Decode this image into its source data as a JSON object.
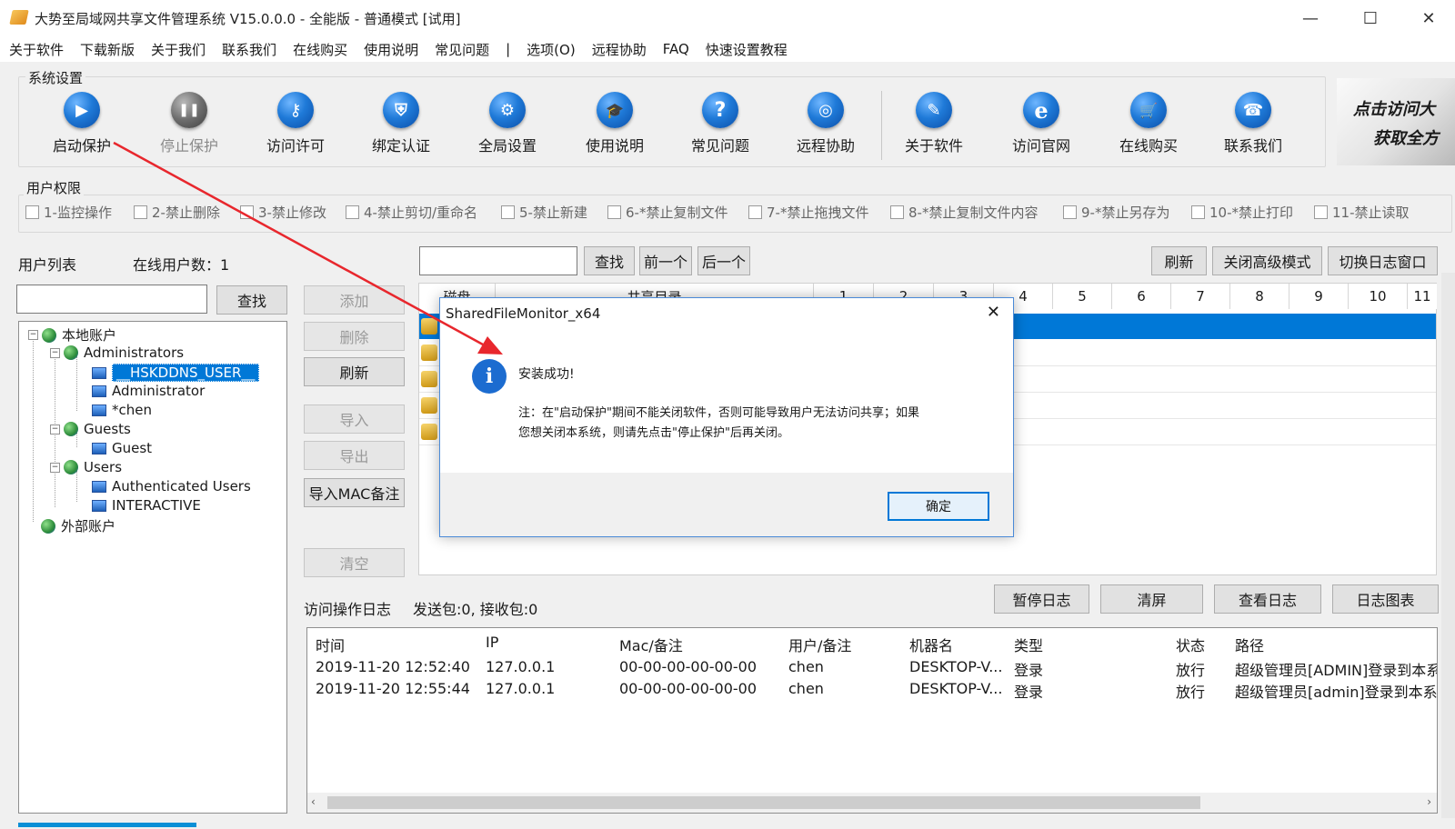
{
  "window": {
    "title": "大势至局域网共享文件管理系统 V15.0.0.0 - 全能版 - 普通模式 [试用]",
    "minimize": "—",
    "maximize": "☐",
    "close": "✕"
  },
  "menu": [
    "关于软件",
    "下载新版",
    "关于我们",
    "联系我们",
    "在线购买",
    "使用说明",
    "常见问题",
    "|",
    "选项(O)",
    "远程协助",
    "FAQ",
    "快速设置教程"
  ],
  "system_settings": {
    "title": "系统设置",
    "tools": [
      {
        "label": "启动保护",
        "icon": "play-icon",
        "glyph": "▶",
        "disabled": false
      },
      {
        "label": "停止保护",
        "icon": "pause-icon",
        "glyph": "❚❚",
        "disabled": true
      },
      {
        "label": "访问许可",
        "icon": "key-icon",
        "glyph": "⚷",
        "disabled": false
      },
      {
        "label": "绑定认证",
        "icon": "shield-icon",
        "glyph": "⛨",
        "disabled": false
      },
      {
        "label": "全局设置",
        "icon": "gear-icon",
        "glyph": "⚙",
        "disabled": false
      },
      {
        "label": "使用说明",
        "icon": "graduation-cap-icon",
        "glyph": "🎓",
        "disabled": false
      },
      {
        "label": "常见问题",
        "icon": "question-icon",
        "glyph": "?",
        "disabled": false
      },
      {
        "label": "远程协助",
        "icon": "globe-hand-icon",
        "glyph": "◎",
        "disabled": false
      },
      {
        "label": "关于软件",
        "icon": "notepad-icon",
        "glyph": "✎",
        "disabled": false
      },
      {
        "label": "访问官网",
        "icon": "ie-icon",
        "glyph": "e",
        "disabled": false
      },
      {
        "label": "在线购买",
        "icon": "cart-icon",
        "glyph": "🛒",
        "disabled": false
      },
      {
        "label": "联系我们",
        "icon": "phone-icon",
        "glyph": "☎",
        "disabled": false
      }
    ],
    "banner_line1": "点击访问大",
    "banner_line2": "获取全方"
  },
  "permissions": {
    "title": "用户权限",
    "items": [
      "1-监控操作",
      "2-禁止删除",
      "3-禁止修改",
      "4-禁止剪切/重命名",
      "5-禁止新建",
      "6-*禁止复制文件",
      "7-*禁止拖拽文件",
      "8-*禁止复制文件内容",
      "9-*禁止另存为",
      "10-*禁止打印",
      "11-禁止读取"
    ]
  },
  "users": {
    "list_label": "用户列表",
    "online_label": "在线用户数：1",
    "search_value": "",
    "search_button": "查找",
    "tree": {
      "local": "本地账户",
      "administrators": "Administrators",
      "hskddns": "__HSKDDNS_USER__",
      "administrator": "Administrator",
      "chen": "*chen",
      "guests": "Guests",
      "guest": "Guest",
      "users_group": "Users",
      "auth_users": "Authenticated Users",
      "interactive": "INTERACTIVE",
      "external": "外部账户"
    }
  },
  "actions": {
    "add": "添加",
    "delete": "删除",
    "refresh": "刷新",
    "import": "导入",
    "export": "导出",
    "import_mac": "导入MAC备注",
    "clear": "清空"
  },
  "share": {
    "search_value": "",
    "find": "查找",
    "prev": "前一个",
    "next": "后一个",
    "refresh": "刷新",
    "close_advanced": "关闭高级模式",
    "switch_log": "切换日志窗口",
    "col_disk": "磁盘",
    "col_dir": "共享目录",
    "num_cols": [
      "1",
      "2",
      "3",
      "4",
      "5",
      "6",
      "7",
      "8",
      "9",
      "10",
      "11"
    ]
  },
  "log": {
    "title": "访问操作日志",
    "packets": "发送包:0, 接收包:0",
    "pause": "暂停日志",
    "clear_screen": "清屏",
    "view": "查看日志",
    "chart": "日志图表",
    "headers": [
      "时间",
      "IP",
      "Mac/备注",
      "用户/备注",
      "机器名",
      "类型",
      "状态",
      "路径"
    ],
    "rows": [
      [
        "2019-11-20 12:52:40",
        "127.0.0.1",
        "00-00-00-00-00-00",
        "chen",
        "DESKTOP-V...",
        "登录",
        "放行",
        "超级管理员[ADMIN]登录到本系"
      ],
      [
        "2019-11-20 12:55:44",
        "127.0.0.1",
        "00-00-00-00-00-00",
        "chen",
        "DESKTOP-V...",
        "登录",
        "放行",
        "超级管理员[admin]登录到本系"
      ]
    ]
  },
  "dialog": {
    "title": "SharedFileMonitor_x64",
    "message": "安装成功!",
    "note_line1": "注：在\"启动保护\"期间不能关闭软件，否则可能导致用户无法访问共享；如果",
    "note_line2": "您想关闭本系统，则请先点击\"停止保护\"后再关闭。",
    "ok": "确定",
    "close": "✕"
  },
  "colors": {
    "accent": "#0078d7",
    "selection": "#0078d7",
    "arrow": "#e8272d"
  }
}
